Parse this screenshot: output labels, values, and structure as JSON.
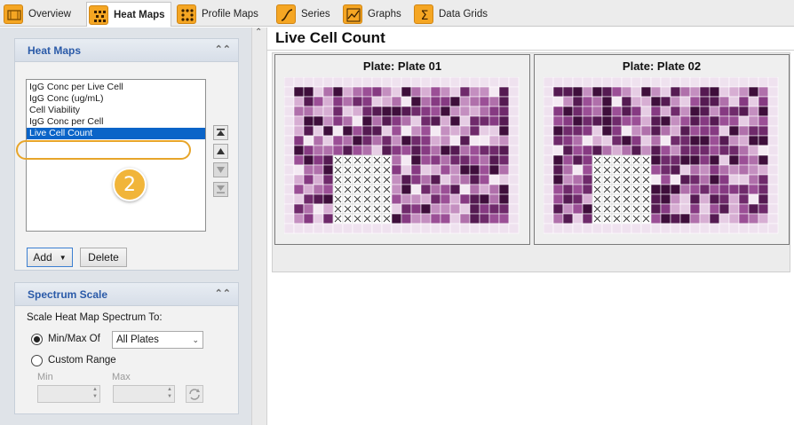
{
  "tabs": [
    {
      "label": "Overview",
      "icon": "overview-icon",
      "active": false
    },
    {
      "label": "Heat Maps",
      "icon": "heat-map-icon",
      "active": true
    },
    {
      "label": "Profile Maps",
      "icon": "profile-map-icon",
      "active": false
    },
    {
      "label": "Series",
      "icon": "series-icon",
      "active": false
    },
    {
      "label": "Graphs",
      "icon": "graph-icon",
      "active": false
    },
    {
      "label": "Data Grids",
      "icon": "sigma-icon",
      "active": false
    }
  ],
  "heatmaps": {
    "title": "Heat Maps",
    "items": [
      "IgG Conc per Live Cell",
      "IgG Conc (ug/mL)",
      "Cell Viability",
      "IgG Conc per Cell",
      "Live Cell Count"
    ],
    "selected_index": 4,
    "add_label": "Add",
    "delete_label": "Delete",
    "callout_number": "2"
  },
  "spectrum": {
    "title": "Spectrum Scale",
    "prompt": "Scale Heat Map Spectrum To:",
    "minmax_label": "Min/Max Of",
    "minmax_value": "All Plates",
    "custom_label": "Custom Range",
    "min_label": "Min",
    "max_label": "Max",
    "min_value": "",
    "max_value": ""
  },
  "main": {
    "title": "Live Cell Count",
    "plates": [
      {
        "title": "Plate: Plate 01"
      },
      {
        "title": "Plate: Plate 02"
      }
    ]
  },
  "colors": {
    "accent": "#f5a623",
    "selection": "#0a64c8",
    "heat_high": "#4d0a3c",
    "heat_low": "#f0e4f0"
  }
}
